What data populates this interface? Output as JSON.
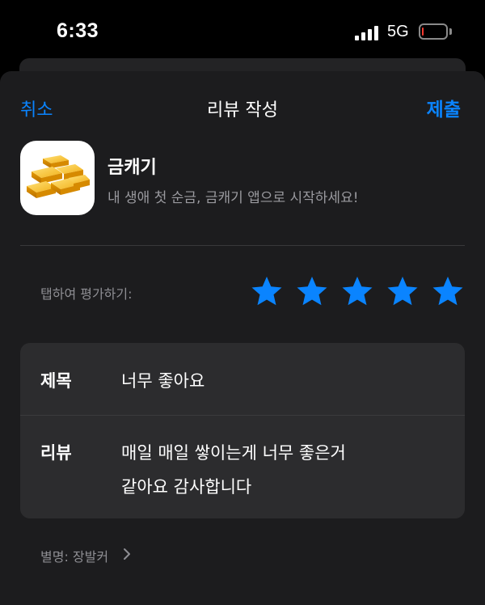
{
  "status_bar": {
    "time": "6:33",
    "network": "5G",
    "battery_level": 0.08
  },
  "nav": {
    "cancel_label": "취소",
    "title": "리뷰 작성",
    "submit_label": "제출"
  },
  "app": {
    "name": "금캐기",
    "subtitle": "내 생애 첫 순금, 금캐기 앱으로 시작하세요!",
    "icon": "gold-bars-icon"
  },
  "rating": {
    "label": "탭하여 평가하기:",
    "value": 5,
    "max": 5,
    "star_color": "#0a84ff"
  },
  "review": {
    "title_label": "제목",
    "title_value": "너무 좋아요",
    "body_label": "리뷰",
    "body_lines": [
      "매일 매일 쌓이는게 너무 좋은거",
      "같아요 감사합니다"
    ]
  },
  "nickname": {
    "label": "별명: 장발커"
  },
  "colors": {
    "accent": "#0a84ff",
    "background": "#000000",
    "sheet": "#1c1c1e",
    "card": "#2c2c2e"
  }
}
